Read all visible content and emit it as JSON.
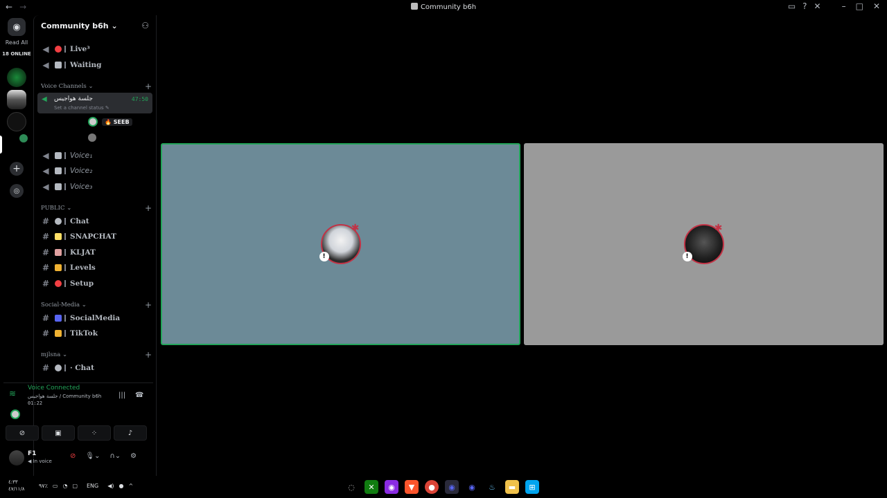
{
  "window": {
    "title": "Community b6h"
  },
  "rail": {
    "read_all": "Read All",
    "online_count": "18 ONLINE"
  },
  "sidebar": {
    "server_name": "Community b6h",
    "top_channels": [
      {
        "label": "Live³",
        "emoji_color": "#f23f43"
      },
      {
        "label": "Waiting",
        "emoji_color": "#b5bac1"
      }
    ],
    "voice_category": "Voice Channels",
    "active_voice": {
      "name": "جلسة هواجيس",
      "timer": "47:50",
      "status_placeholder": "Set a channel status"
    },
    "members": [
      {
        "tag": "SEEB"
      }
    ],
    "voice_channels": [
      "Voice₁",
      "Voice₂",
      "Voice₃"
    ],
    "public_category": "PUBLIC",
    "public_channels": [
      {
        "label": "Chat",
        "emoji_color": "#b5bac1"
      },
      {
        "label": "SNAPCHAT",
        "emoji_color": "#ffe066"
      },
      {
        "label": "KLJAT",
        "emoji_color": "#e0a0a0"
      },
      {
        "label": "Levels",
        "emoji_color": "#f0b232"
      },
      {
        "label": "Setup",
        "emoji_color": "#f23f43"
      }
    ],
    "social_category": "Social-Media",
    "social_channels": [
      {
        "label": "SocialMedia",
        "emoji_color": "#5865f2"
      },
      {
        "label": "TikTok",
        "emoji_color": "#f0b232"
      }
    ],
    "mjlsna_category": "mjlsna",
    "mjlsna_channels": [
      {
        "label": "· Chat",
        "emoji_color": "#b5bac1"
      }
    ]
  },
  "voice_panel": {
    "title": "Voice Connected",
    "subtitle": "جلسة هواجيس / Community b6h",
    "elapsed": "01:22"
  },
  "user": {
    "name": "F1",
    "status": "In voice"
  },
  "taskbar": {
    "clock_time": "٤:٣٣",
    "clock_date": "٤٧/١١/٨",
    "battery": "٩٧٪",
    "language": "ENG"
  },
  "colors": {
    "accent_green": "#23a55a",
    "tile1_bg": "#6c8a97",
    "tile2_bg": "#9a9a9a",
    "alert_red": "#c23245"
  }
}
